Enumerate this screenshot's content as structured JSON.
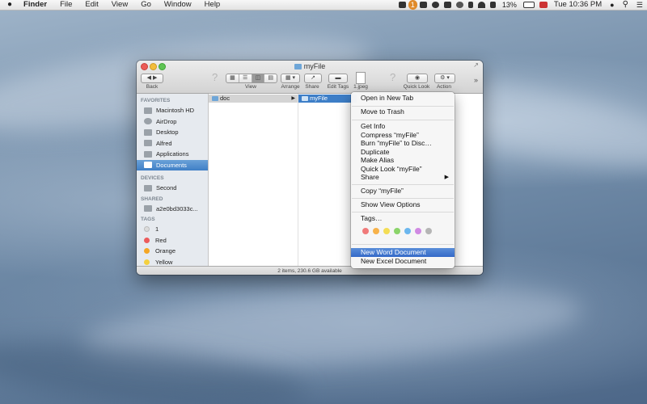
{
  "menubar": {
    "app": "Finder",
    "items": [
      "File",
      "Edit",
      "View",
      "Go",
      "Window",
      "Help"
    ],
    "status": {
      "badge": "1",
      "battery": "13%",
      "clock": "Tue 10:36 PM"
    }
  },
  "window": {
    "title": "myFile",
    "toolbar": {
      "back": "Back",
      "view": "View",
      "arrange": "Arrange",
      "share": "Share",
      "edit_tags": "Edit Tags",
      "file_item": "1.jpeg",
      "quick_look": "Quick Look",
      "action": "Action"
    },
    "sidebar": {
      "favorites_header": "FAVORITES",
      "favorites": [
        "Macintosh HD",
        "AirDrop",
        "Desktop",
        "Alfred",
        "Applications",
        "Documents"
      ],
      "devices_header": "DEVICES",
      "devices": [
        "Second"
      ],
      "shared_header": "SHARED",
      "shared": [
        "a2e0bd3033c..."
      ],
      "tags_header": "TAGS",
      "tags": [
        {
          "label": "1",
          "color": "#dcdcdc"
        },
        {
          "label": "Red",
          "color": "#ec5b5b"
        },
        {
          "label": "Orange",
          "color": "#f5a623"
        },
        {
          "label": "Yellow",
          "color": "#f4d03f"
        }
      ]
    },
    "columns": {
      "col1": [
        "doc"
      ],
      "col2": [
        "myFile"
      ]
    },
    "statusbar": "2 items, 230.6 GB available"
  },
  "context_menu": {
    "items": [
      "Open in New Tab",
      "Move to Trash",
      "Get Info",
      "Compress “myFile”",
      "Burn “myFile” to Disc…",
      "Duplicate",
      "Make Alias",
      "Quick Look “myFile”",
      "Share",
      "Copy “myFile”",
      "Show View Options",
      "Tags…",
      "New Word Document",
      "New Excel Document"
    ],
    "tag_colors": [
      "#f07a7a",
      "#f7b24a",
      "#f4dd55",
      "#8bd46a",
      "#6cb7ee",
      "#d08ae3",
      "#b5b5b5"
    ]
  },
  "colors": {
    "selection": "#3d7ec7",
    "highlight": "#3469c8"
  }
}
